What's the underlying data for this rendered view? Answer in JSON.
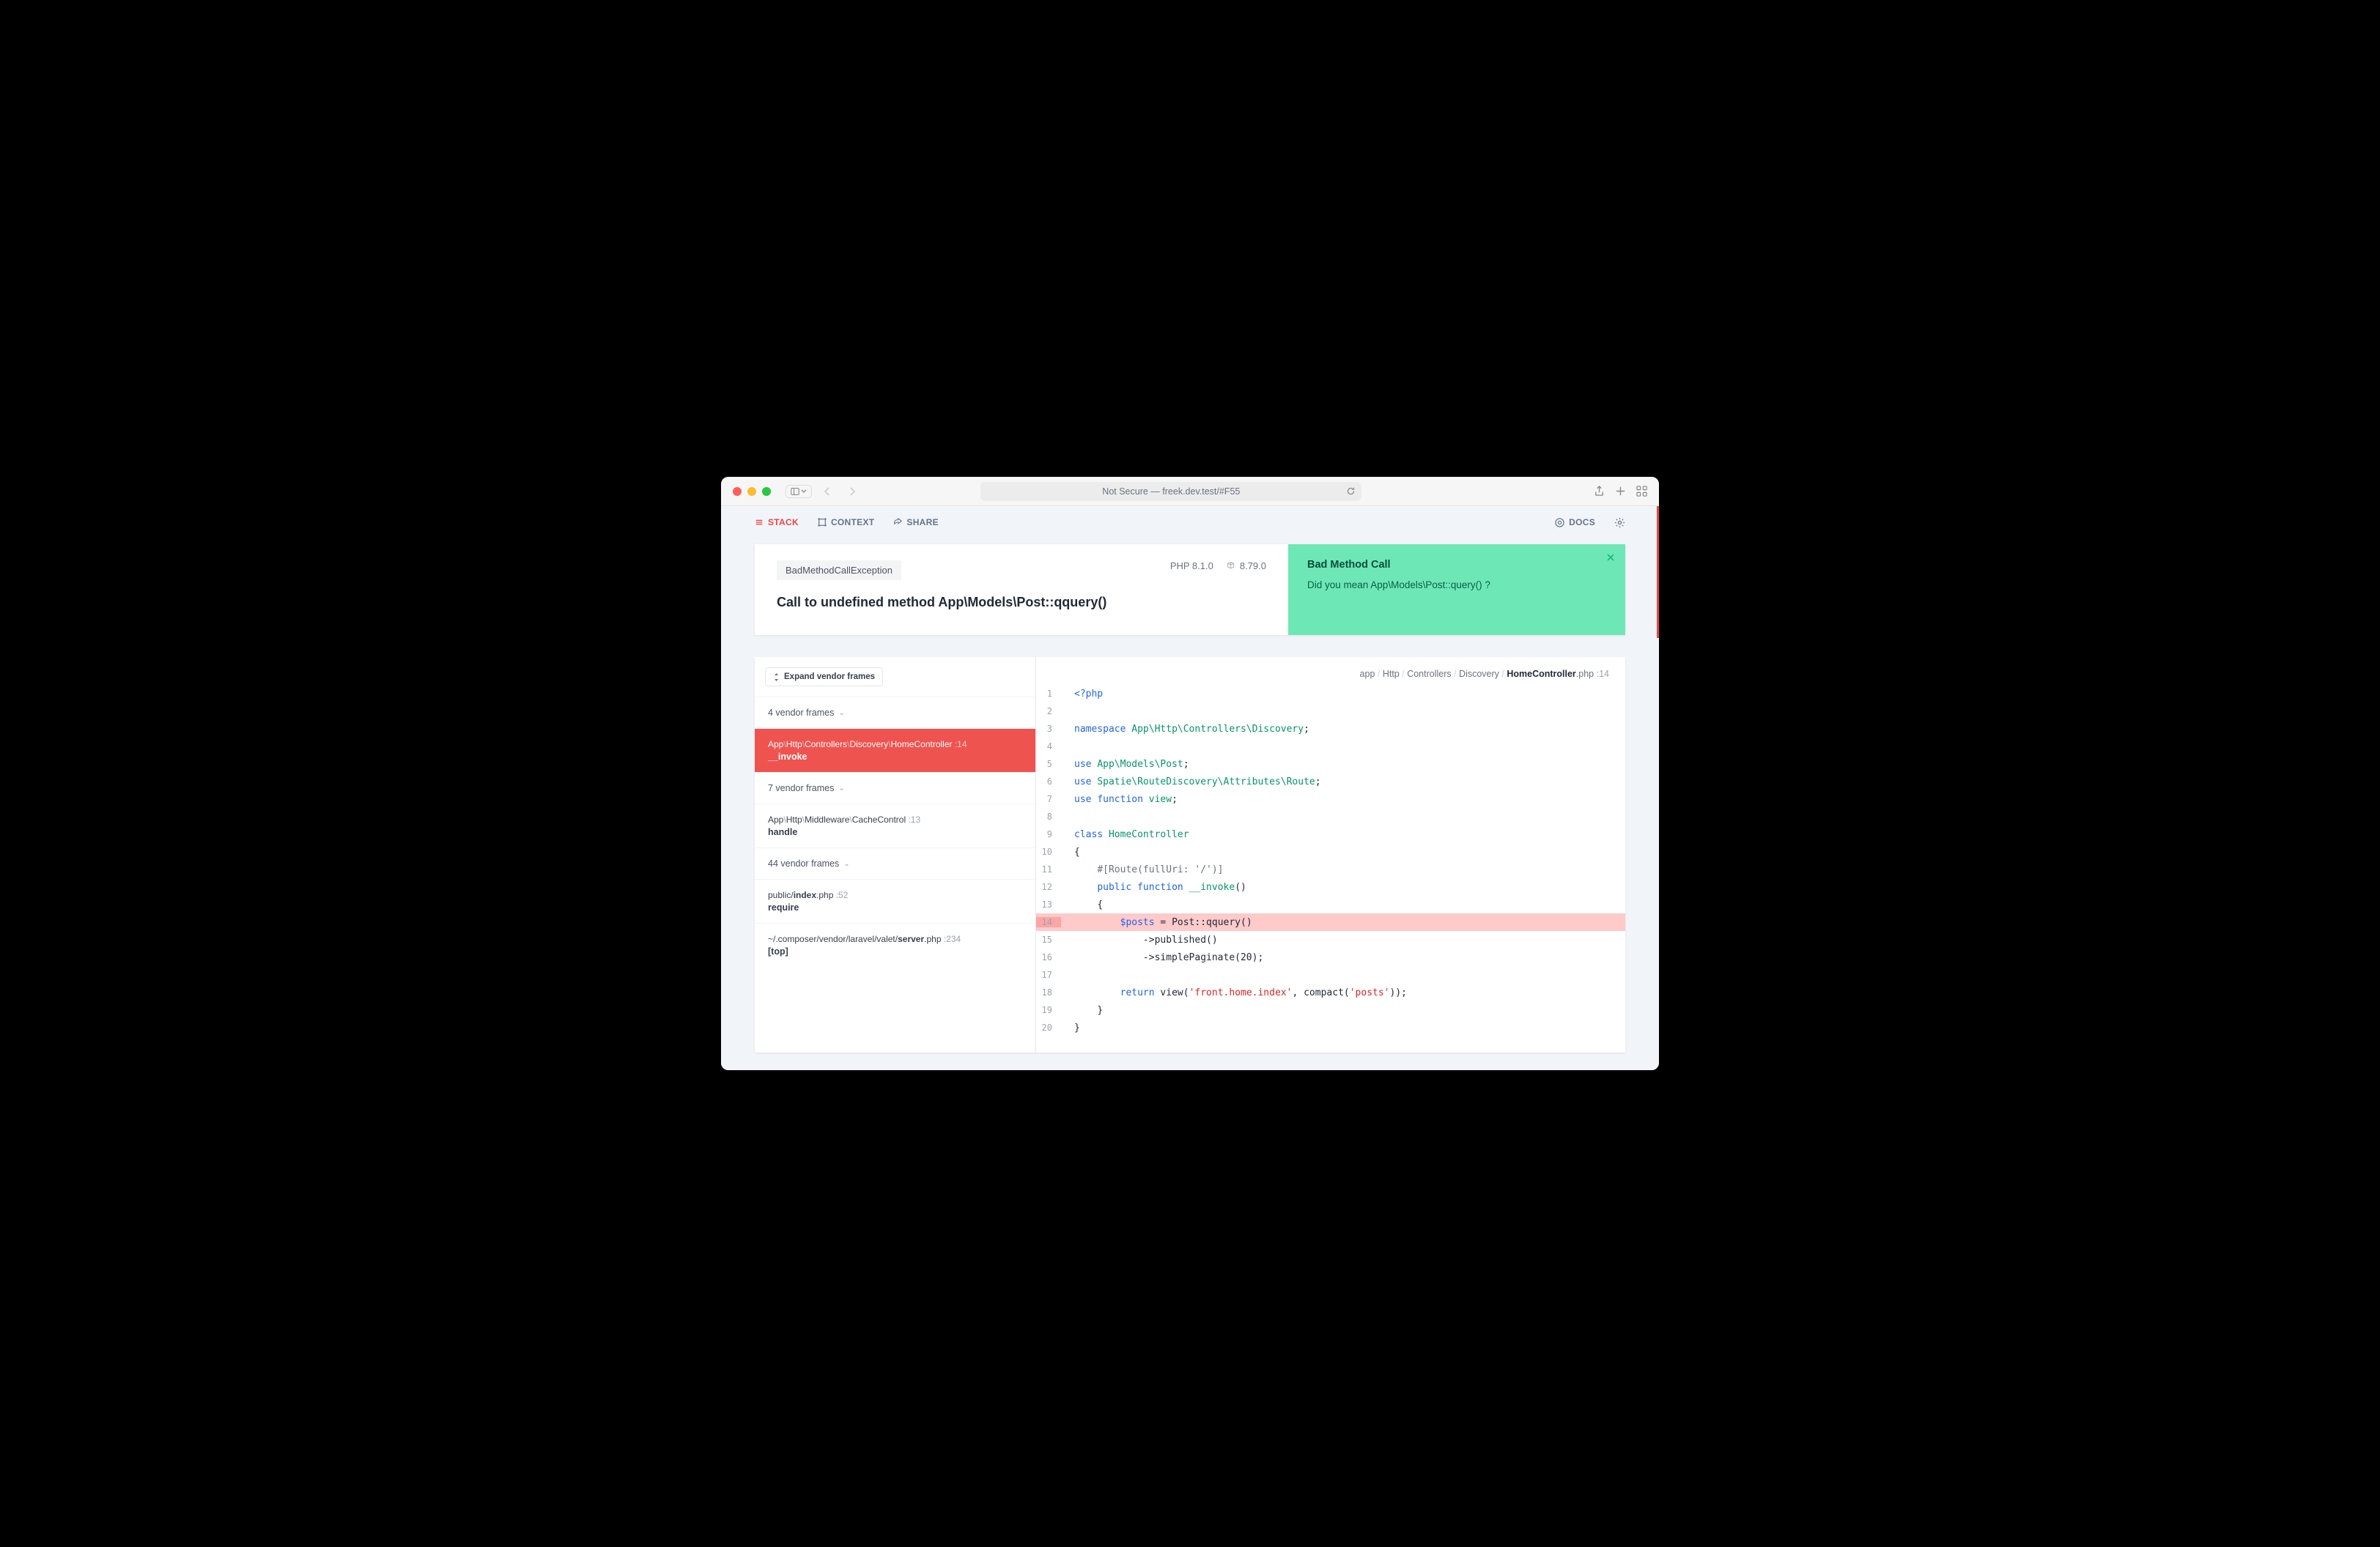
{
  "browser": {
    "url_label": "Not Secure — freek.dev.test/#F55"
  },
  "appbar": {
    "tabs": {
      "stack": "STACK",
      "context": "CONTEXT",
      "share": "SHARE"
    },
    "docs": "DOCS"
  },
  "exception": {
    "class": "BadMethodCallException",
    "message": "Call to undefined method App\\Models\\Post::qquery()",
    "php_version": "PHP 8.1.0",
    "laravel_version": "8.79.0"
  },
  "solution": {
    "title": "Bad Method Call",
    "body": "Did you mean App\\Models\\Post::query() ?"
  },
  "frames": {
    "expand_label": "Expand vendor frames",
    "items": [
      {
        "type": "group",
        "label": "4 vendor frames"
      },
      {
        "type": "frame",
        "active": true,
        "path": "App\\Http\\Controllers\\Discovery\\HomeController",
        "line": "14",
        "fn": "__invoke"
      },
      {
        "type": "group",
        "label": "7 vendor frames"
      },
      {
        "type": "frame",
        "path": "App\\Http\\Middleware\\CacheControl",
        "line": "13",
        "fn": "handle"
      },
      {
        "type": "group",
        "label": "44 vendor frames"
      },
      {
        "type": "frame",
        "path_html": "public/<b>index</b>.php",
        "line": "52",
        "fn": "require"
      },
      {
        "type": "frame",
        "path_html": "~/.composer/vendor/laravel/valet/<b>server</b>.php",
        "line": "234",
        "fn": "[top]"
      }
    ]
  },
  "code": {
    "path_segments": [
      "app",
      "Http",
      "Controllers",
      "Discovery"
    ],
    "path_file": "HomeController",
    "path_ext": ".php",
    "path_line": "14",
    "highlight_line": 14,
    "lines": [
      {
        "n": 1,
        "html": "<span class='k'>&lt;?php</span>"
      },
      {
        "n": 2,
        "html": ""
      },
      {
        "n": 3,
        "html": "<span class='k'>namespace</span> <span class='ns'>App\\Http\\Controllers\\Discovery</span><span class='p'>;</span>"
      },
      {
        "n": 4,
        "html": ""
      },
      {
        "n": 5,
        "html": "<span class='k'>use</span> <span class='ns'>App\\Models\\Post</span><span class='p'>;</span>"
      },
      {
        "n": 6,
        "html": "<span class='k'>use</span> <span class='ns'>Spatie\\RouteDiscovery\\Attributes\\Route</span><span class='p'>;</span>"
      },
      {
        "n": 7,
        "html": "<span class='k'>use</span> <span class='k'>function</span> <span class='ns'>view</span><span class='p'>;</span>"
      },
      {
        "n": 8,
        "html": ""
      },
      {
        "n": 9,
        "html": "<span class='k'>class</span> <span class='ns'>HomeController</span>"
      },
      {
        "n": 10,
        "html": "<span class='p'>{</span>"
      },
      {
        "n": 11,
        "html": "    <span class='c'>#[Route(fullUri: '/')]</span>"
      },
      {
        "n": 12,
        "html": "    <span class='k'>public</span> <span class='k'>function</span> <span class='fn2'>__invoke</span><span class='p'>()</span>"
      },
      {
        "n": 13,
        "html": "    <span class='p'>{</span>"
      },
      {
        "n": 14,
        "html": "        <span class='v'>$posts</span> <span class='p'>= Post::qquery()</span>"
      },
      {
        "n": 15,
        "html": "            <span class='p'>-&gt;published()</span>"
      },
      {
        "n": 16,
        "html": "            <span class='p'>-&gt;simplePaginate(</span><span class='n'>20</span><span class='p'>);</span>"
      },
      {
        "n": 17,
        "html": ""
      },
      {
        "n": 18,
        "html": "        <span class='k'>return</span> <span class='p'>view(</span><span class='s'>'front.home.index'</span><span class='p'>, compact(</span><span class='s'>'posts'</span><span class='p'>));</span>"
      },
      {
        "n": 19,
        "html": "    <span class='p'>}</span>"
      },
      {
        "n": 20,
        "html": "<span class='p'>}</span>"
      }
    ]
  }
}
